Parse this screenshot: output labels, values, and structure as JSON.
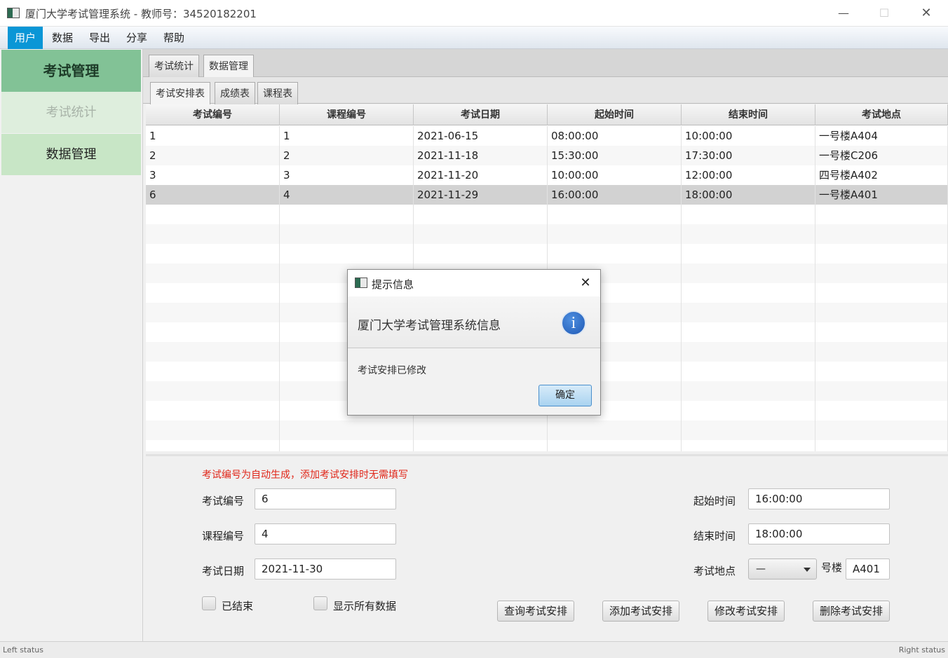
{
  "window": {
    "title": "厦门大学考试管理系统 - 教师号：34520182201",
    "min_glyph": "—",
    "max_glyph": "☐",
    "close_glyph": "✕"
  },
  "menu": [
    "用户",
    "数据",
    "导出",
    "分享",
    "帮助"
  ],
  "sidebar": {
    "header": "考试管理",
    "items": [
      "考试统计",
      "数据管理"
    ]
  },
  "tabs_top": [
    "考试统计",
    "数据管理"
  ],
  "tabs_sub": [
    "考试安排表",
    "成绩表",
    "课程表"
  ],
  "table": {
    "columns": [
      "考试编号",
      "课程编号",
      "考试日期",
      "起始时间",
      "结束时间",
      "考试地点"
    ],
    "rows": [
      [
        "1",
        "1",
        "2021-06-15",
        "08:00:00",
        "10:00:00",
        "一号楼A404"
      ],
      [
        "2",
        "2",
        "2021-11-18",
        "15:30:00",
        "17:30:00",
        "一号楼C206"
      ],
      [
        "3",
        "3",
        "2021-11-20",
        "10:00:00",
        "12:00:00",
        "四号楼A402"
      ],
      [
        "6",
        "4",
        "2021-11-29",
        "16:00:00",
        "18:00:00",
        "一号楼A401"
      ]
    ],
    "selected_row": 3
  },
  "form": {
    "hint": "考试编号为自动生成，添加考试安排时无需填写",
    "exam_id_label": "考试编号",
    "exam_id_value": "6",
    "course_id_label": "课程编号",
    "course_id_value": "4",
    "exam_date_label": "考试日期",
    "exam_date_value": "2021-11-30",
    "start_label": "起始时间",
    "start_value": "16:00:00",
    "end_label": "结束时间",
    "end_value": "18:00:00",
    "location_label": "考试地点",
    "building_value": "—",
    "floor_suffix": "号楼",
    "room_value": "A401",
    "finished_label": "已结束",
    "show_all_label": "显示所有数据",
    "buttons": [
      "查询考试安排",
      "添加考试安排",
      "修改考试安排",
      "删除考试安排"
    ]
  },
  "status": {
    "left": "Left status",
    "right": "Right status"
  },
  "dialog": {
    "title": "提示信息",
    "heading": "厦门大学考试管理系统信息",
    "info_glyph": "i",
    "message": "考试安排已修改",
    "ok": "确定",
    "close_glyph": "✕"
  }
}
